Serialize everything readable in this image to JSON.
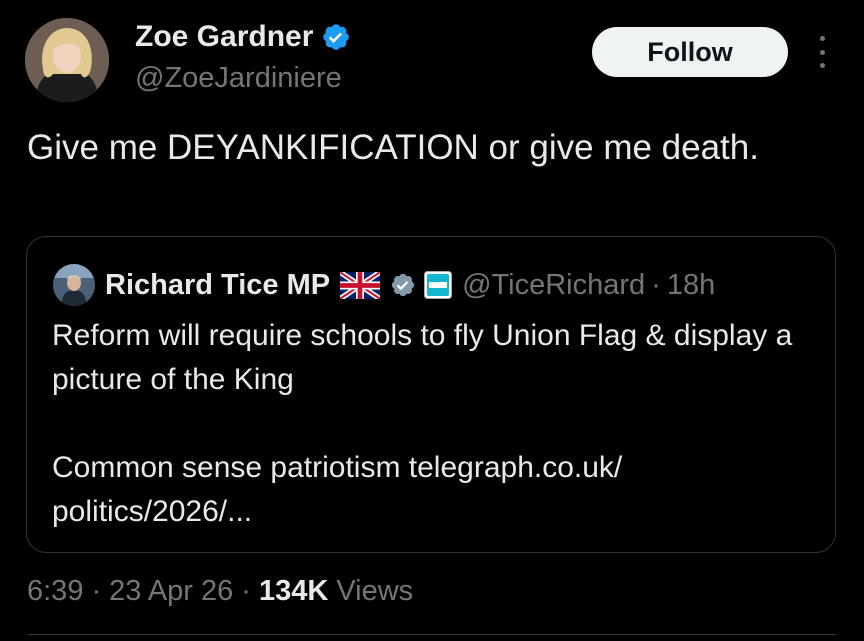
{
  "author": {
    "name": "Zoe Gardner",
    "handle": "@ZoeJardiniere",
    "verified_icon": "verified-badge-icon"
  },
  "follow_button": {
    "label": "Follow"
  },
  "more_button": {
    "icon": "more-vertical-icon"
  },
  "tweet": {
    "text": "Give me DEYANKIFICATION or give me death."
  },
  "quoted_tweet": {
    "author_name": "Richard Tice MP",
    "flag_icon": "uk-flag-icon",
    "verified_icon": "verified-badge-icon",
    "affiliate_icon": "reform-uk-affiliate-icon",
    "handle": "@TiceRichard",
    "separator": "·",
    "time": "18h",
    "text_line1": "Reform will require schools to fly Union Flag & display a picture of the King",
    "text_line2": "Common sense patriotism  telegraph.co.uk/ politics/2026/..."
  },
  "meta": {
    "time": "6:39",
    "sep1": "·",
    "date": "23 Apr 26",
    "sep2": "·",
    "views_count": "134K",
    "views_label": "Views"
  },
  "colors": {
    "background": "#000000",
    "text_primary": "#e7e9ea",
    "text_secondary": "#71767b",
    "verified_blue": "#1d9bf0",
    "border": "#2f3336"
  }
}
